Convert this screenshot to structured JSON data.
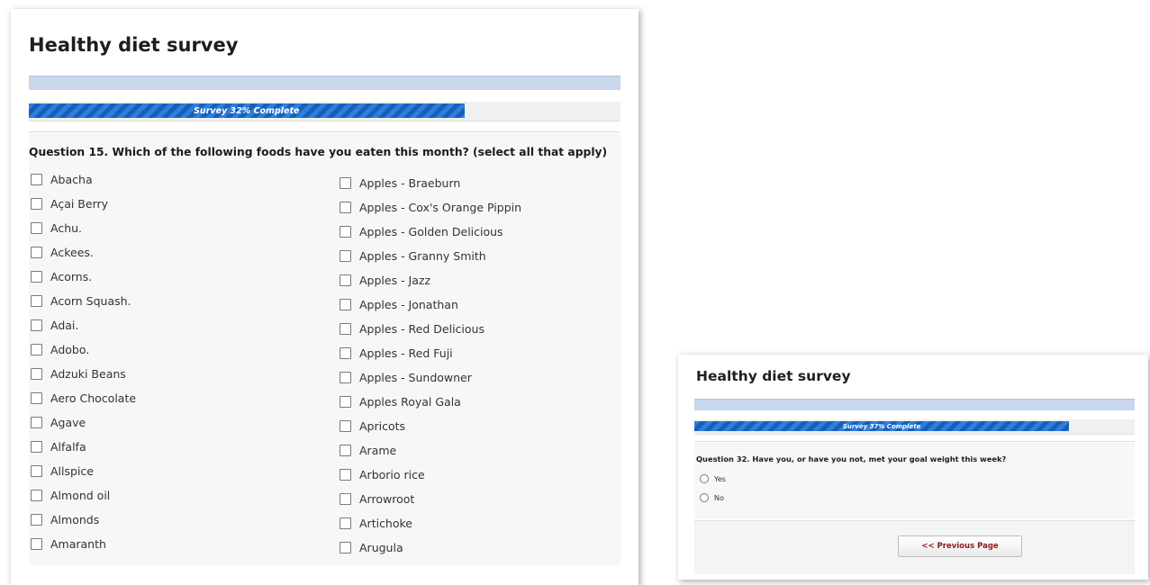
{
  "main": {
    "title": "Healthy diet survey",
    "progress": {
      "label": "Survey 32% Complete",
      "percent": 32
    },
    "question": "Question 15. Which of the following foods have you eaten this month? (select all that apply)",
    "options_left": [
      "Abacha",
      "Açai Berry",
      "Achu.",
      "Ackees.",
      "Acorns.",
      "Acorn Squash.",
      "Adai.",
      "Adobo.",
      "Adzuki Beans",
      "Aero Chocolate",
      "Agave",
      "Alfalfa",
      "Allspice",
      "Almond oil",
      "Almonds",
      "Amaranth"
    ],
    "options_right": [
      "Apples - Braeburn",
      "Apples - Cox's Orange Pippin",
      "Apples - Golden Delicious",
      "Apples - Granny Smith",
      "Apples - Jazz",
      "Apples - Jonathan",
      "Apples - Red Delicious",
      "Apples - Red Fuji",
      "Apples - Sundowner",
      "Apples Royal Gala",
      "Apricots",
      "Arame",
      "Arborio rice",
      "Arrowroot",
      "Artichoke",
      "Arugula"
    ]
  },
  "small": {
    "title": "Healthy diet survey",
    "progress": {
      "label": "Survey 37% Complete",
      "percent": 37
    },
    "question": "Question 32. Have you, or have you not, met your goal weight this week?",
    "radio_options": [
      "Yes",
      "No"
    ],
    "prev_button": "<< Previous Page"
  }
}
